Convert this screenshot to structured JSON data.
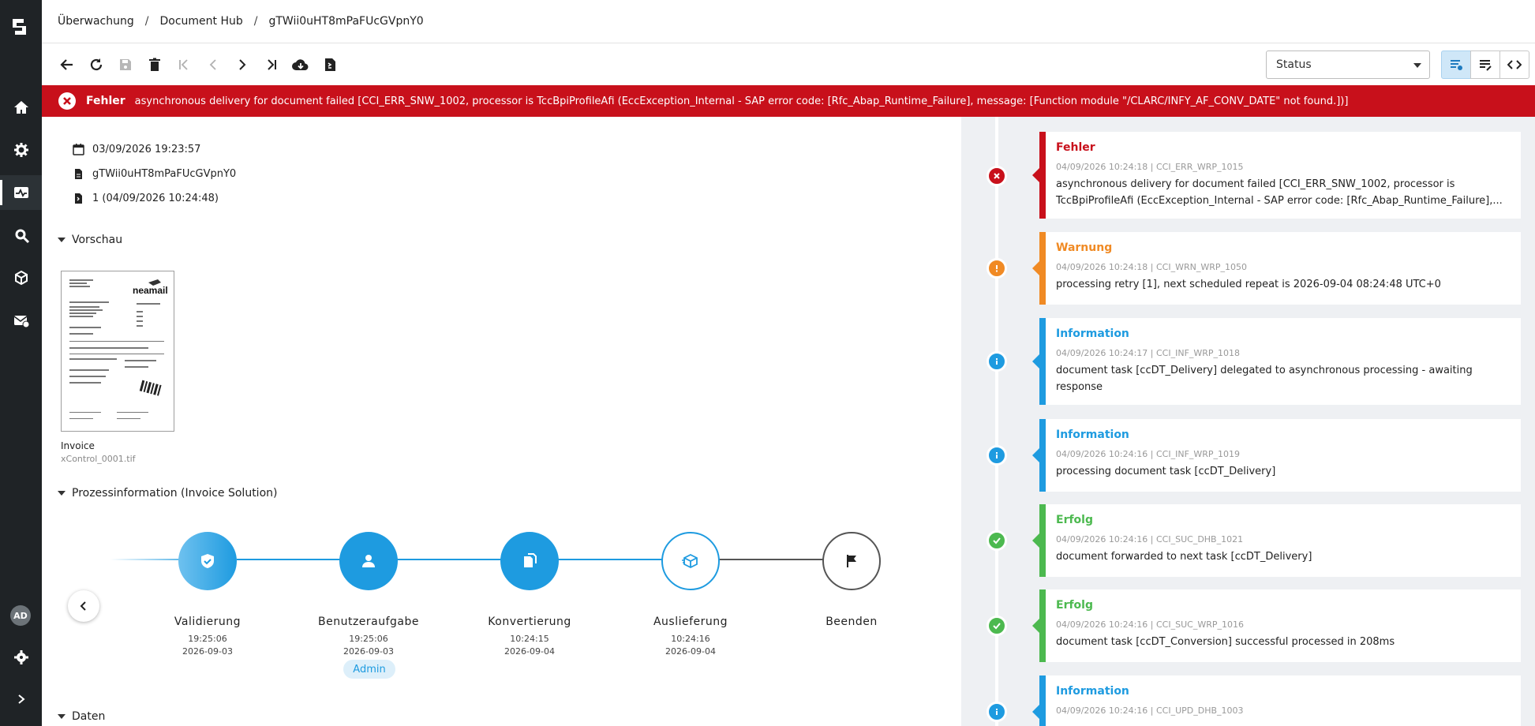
{
  "app": {
    "user_initials": "AD"
  },
  "breadcrumb": [
    "Überwachung",
    "Document Hub",
    "gTWii0uHT8mPaFUcGVpnY0"
  ],
  "toolbar": {
    "status_value": "Status"
  },
  "banner": {
    "title": "Fehler",
    "message": "asynchronous delivery for document failed [CCI_ERR_SNW_1002, processor is TccBpiProfileAfi (EccException_Internal - SAP error code: [Rfc_Abap_Runtime_Failure], message: [Function module \"/CLARC/INFY_AF_CONV_DATE\" not found.])]"
  },
  "meta": {
    "date": "03/09/2026 19:23:57",
    "doc_id": "gTWii0uHT8mPaFUcGVpnY0",
    "version": "1 (04/09/2026 10:24:48)"
  },
  "sections": {
    "preview": "Vorschau",
    "process": "Prozessinformation (Invoice Solution)",
    "data": "Daten"
  },
  "preview": {
    "label": "Invoice",
    "file": "xControl_0001.tif",
    "thumb_logo": "neamail"
  },
  "process_steps": [
    {
      "label": "Validierung",
      "time": "19:25:06",
      "date": "2026-09-03"
    },
    {
      "label": "Benutzeraufgabe",
      "time": "19:25:06",
      "date": "2026-09-03",
      "badge": "Admin"
    },
    {
      "label": "Konvertierung",
      "time": "10:24:15",
      "date": "2026-09-04"
    },
    {
      "label": "Auslieferung",
      "time": "10:24:16",
      "date": "2026-09-04"
    },
    {
      "label": "Beenden",
      "time": "",
      "date": ""
    }
  ],
  "colors": {
    "error": "#c8101b",
    "warning": "#f08a24",
    "info": "#1e9be0",
    "success": "#4cb94f"
  },
  "log": [
    {
      "level": "error",
      "title": "Fehler",
      "meta": "04/09/2026 10:24:18 | CCI_ERR_WRP_1015",
      "desc": "asynchronous delivery for document failed [CCI_ERR_SNW_1002, processor is TccBpiProfileAfi (EccException_Internal - SAP error code: [Rfc_Abap_Runtime_Failure],..."
    },
    {
      "level": "warning",
      "title": "Warnung",
      "meta": "04/09/2026 10:24:18 | CCI_WRN_WRP_1050",
      "desc": "processing retry [1], next scheduled repeat is 2026-09-04 08:24:48 UTC+0"
    },
    {
      "level": "info",
      "title": "Information",
      "meta": "04/09/2026 10:24:17 | CCI_INF_WRP_1018",
      "desc": "document task [ccDT_Delivery] delegated to asynchronous processing - awaiting response"
    },
    {
      "level": "info",
      "title": "Information",
      "meta": "04/09/2026 10:24:16 | CCI_INF_WRP_1019",
      "desc": "processing document task [ccDT_Delivery]"
    },
    {
      "level": "success",
      "title": "Erfolg",
      "meta": "04/09/2026 10:24:16 | CCI_SUC_DHB_1021",
      "desc": "document forwarded to next task [ccDT_Delivery]"
    },
    {
      "level": "success",
      "title": "Erfolg",
      "meta": "04/09/2026 10:24:16 | CCI_SUC_WRP_1016",
      "desc": "document task [ccDT_Conversion] successful processed in 208ms"
    },
    {
      "level": "info",
      "title": "Information",
      "meta": "04/09/2026 10:24:16 | CCI_UPD_DHB_1003",
      "desc": ""
    }
  ]
}
